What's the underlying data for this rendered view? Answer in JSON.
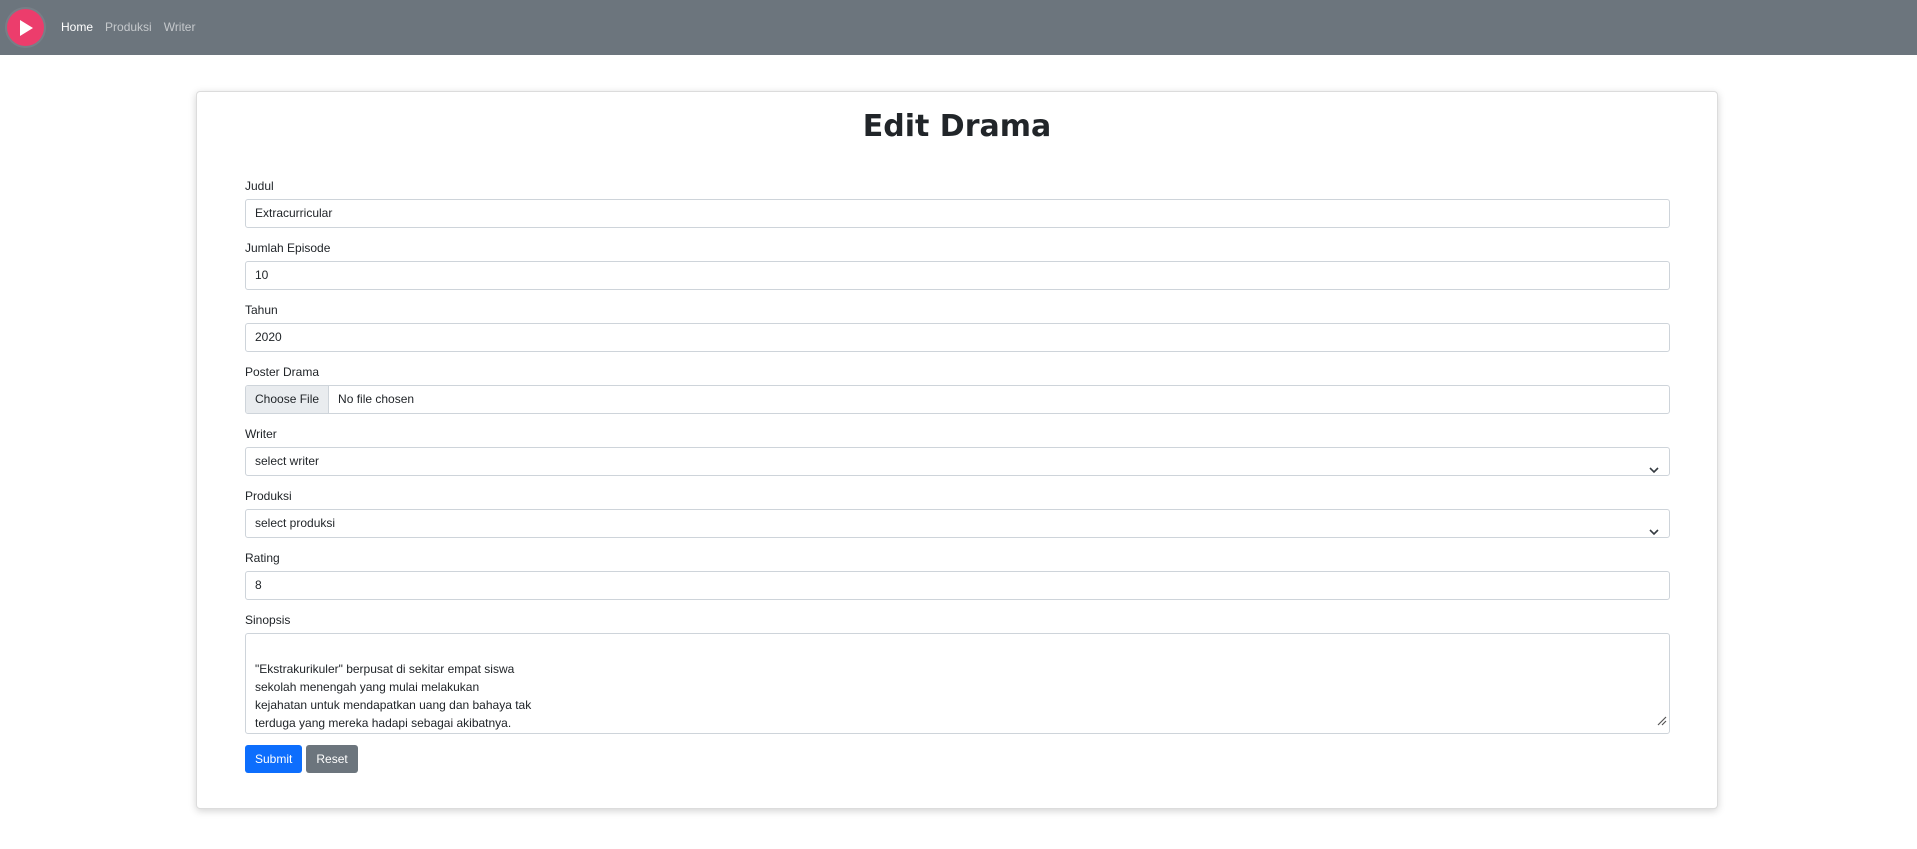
{
  "nav": {
    "links": [
      {
        "label": "Home",
        "active": true
      },
      {
        "label": "Produksi",
        "active": false
      },
      {
        "label": "Writer",
        "active": false
      }
    ]
  },
  "form": {
    "title": "Edit Drama",
    "judul": {
      "label": "Judul",
      "value": "Extracurricular"
    },
    "episode": {
      "label": "Jumlah Episode",
      "value": "10"
    },
    "tahun": {
      "label": "Tahun",
      "value": "2020"
    },
    "poster": {
      "label": "Poster Drama",
      "button": "Choose File",
      "status": "No file chosen"
    },
    "writer": {
      "label": "Writer",
      "selected": "select writer"
    },
    "produksi": {
      "label": "Produksi",
      "selected": "select produksi"
    },
    "rating": {
      "label": "Rating",
      "value": "8"
    },
    "sinopsis": {
      "label": "Sinopsis",
      "value": "\"Ekstrakurikuler\" berpusat di sekitar empat siswa\nsekolah menengah yang mulai melakukan\nkejahatan untuk mendapatkan uang dan bahaya tak\nterduga yang mereka hadapi sebagai akibatnya."
    },
    "submit_label": "Submit",
    "reset_label": "Reset"
  },
  "colors": {
    "navbar": "#6c757d",
    "logo": "#ec3d6c",
    "primary": "#0d6efd",
    "secondary": "#6c757d"
  }
}
